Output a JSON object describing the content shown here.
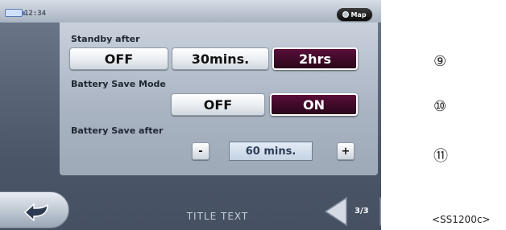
{
  "status": {
    "time": "12:34",
    "map_label": "Map"
  },
  "settings": {
    "standby": {
      "label": "Standby after",
      "options": [
        "OFF",
        "30mins.",
        "2hrs"
      ],
      "selected": "2hrs"
    },
    "battery_mode": {
      "label": "Battery Save Mode",
      "options": [
        "OFF",
        "ON"
      ],
      "selected": "ON"
    },
    "battery_after": {
      "label": "Battery Save after",
      "minus": "-",
      "value": "60 mins.",
      "plus": "+"
    }
  },
  "bottom": {
    "title": "TITLE TEXT",
    "page": "3/3"
  },
  "callouts": [
    "⑨",
    "⑩",
    "⑪"
  ],
  "caption": "<SS1200c>",
  "colors": {
    "active_button": "#3e0a27",
    "panel": "#b8c1ce",
    "screen_bg": "#5b6778"
  }
}
